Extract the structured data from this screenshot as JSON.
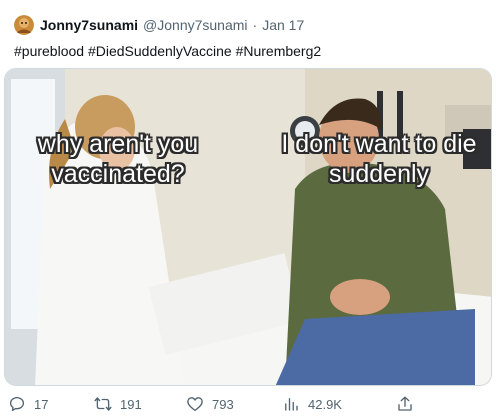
{
  "tweet": {
    "display_name": "Jonny7sunami",
    "handle": "@Jonny7sunami",
    "separator": "·",
    "date": "Jan 17",
    "text": "#pureblood #DiedSuddenlyVaccine #Nuremberg2"
  },
  "media": {
    "caption_left": "why aren't you vaccinated?",
    "caption_right": "I don't want to die suddenly"
  },
  "actions": {
    "replies": "17",
    "retweets": "191",
    "likes": "793",
    "views": "42.9K"
  },
  "icons": {
    "reply": "reply-icon",
    "retweet": "retweet-icon",
    "like": "heart-icon",
    "views": "views-icon",
    "share": "share-icon"
  },
  "colors": {
    "text_primary": "#0f1419",
    "text_secondary": "#536471",
    "border": "#cfd9de"
  }
}
